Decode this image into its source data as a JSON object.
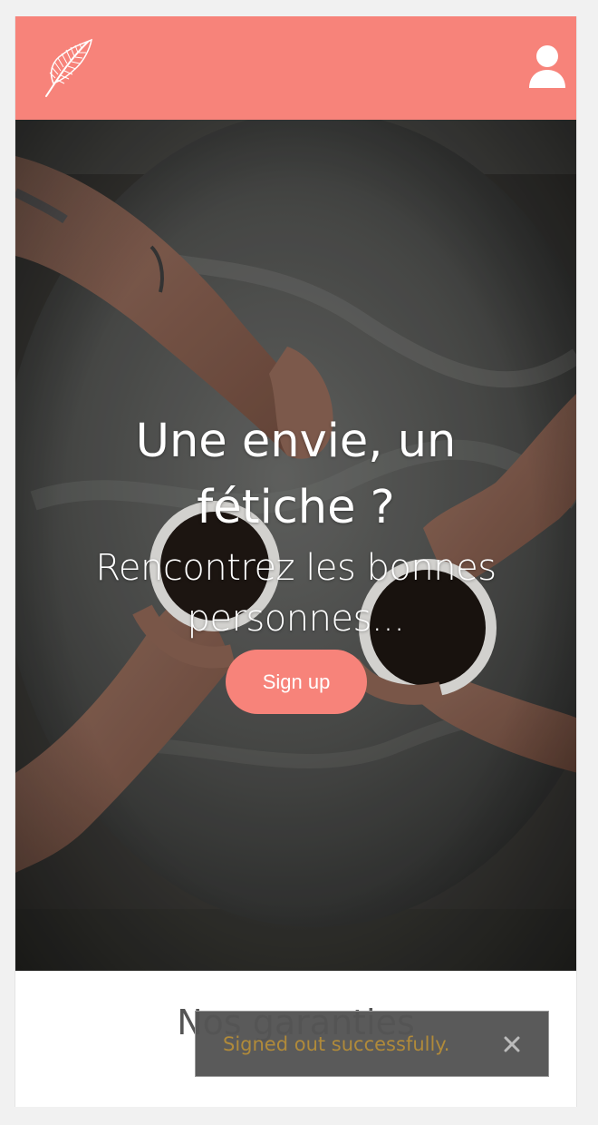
{
  "header": {
    "background_color": "#f7837a",
    "logo_icon": "feather-icon",
    "user_icon": "user-icon"
  },
  "hero": {
    "title": "Une envie, un fétiche ?",
    "subtitle": "Rencontrez les bonnes personnes...",
    "signup_label": "Sign up"
  },
  "guarantees": {
    "title": "Nos garanties"
  },
  "toast": {
    "message": "Signed out successfully.",
    "close_icon": "close-icon"
  }
}
